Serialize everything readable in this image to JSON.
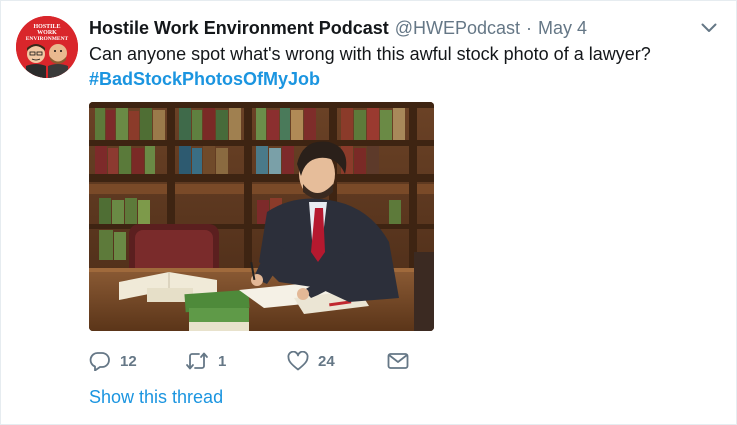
{
  "tweet": {
    "author_name": "Hostile Work Environment Podcast",
    "handle": "@HWEPodcast",
    "separator": "·",
    "date": "May 4",
    "text": "Can anyone spot what's wrong with this awful stock photo of a lawyer?",
    "hashtag": "#BadStockPhotosOfMyJob",
    "avatar_text": [
      "HOSTILE",
      "WORK",
      "ENVIRONMENT"
    ],
    "actions": {
      "reply_count": "12",
      "retweet_count": "1",
      "like_count": "24"
    },
    "show_thread": "Show this thread"
  },
  "icons": {
    "caret": "chevron-down-icon",
    "reply": "reply-icon",
    "retweet": "retweet-icon",
    "like": "heart-icon",
    "dm": "envelope-icon"
  },
  "colors": {
    "link": "#1b95e0",
    "secondary": "#657786",
    "avatar_bg": "#d9262b"
  }
}
